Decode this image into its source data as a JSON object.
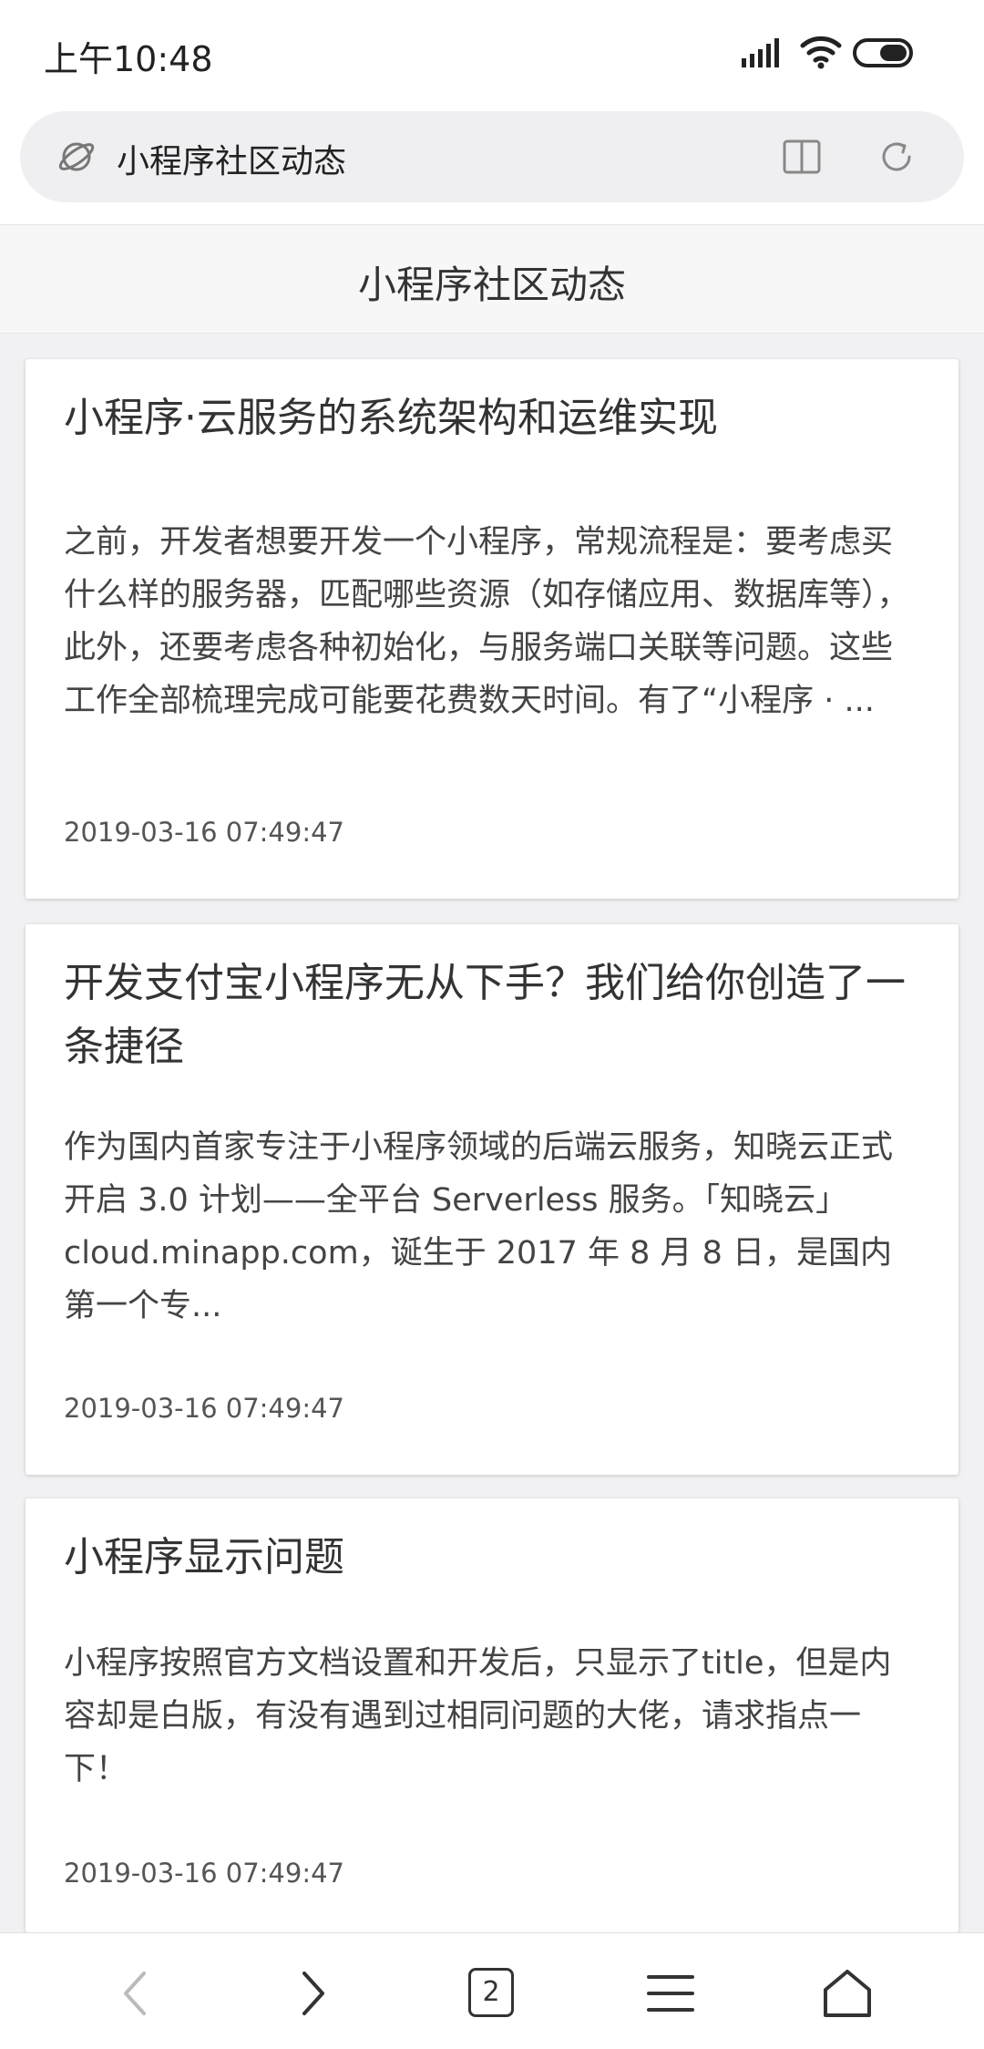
{
  "status_bar": {
    "time": "上午10:48"
  },
  "browser": {
    "address": "小程序社区动态",
    "tab_count": "2"
  },
  "page": {
    "title": "小程序社区动态"
  },
  "posts": [
    {
      "title": "小程序·云服务的系统架构和运维实现",
      "summary": "之前，开发者想要开发一个小程序，常规流程是：要考虑买什么样的服务器，匹配哪些资源（如存储应用、数据库等），此外，还要考虑各种初始化，与服务端口关联等问题。这些工作全部梳理完成可能要花费数天时间。有了“小程序 · ...",
      "date": "2019-03-16 07:49:47"
    },
    {
      "title": "开发支付宝小程序无从下手？我们给你创造了一条捷径",
      "summary": "作为国内首家专注于小程序领域的后端云服务，知晓云正式开启 3.0 计划——全平台 Serverless 服务。「知晓云」cloud.minapp.com，诞生于 2017 年 8 月 8 日，是国内第一个专...",
      "date": "2019-03-16 07:49:47"
    },
    {
      "title": "小程序显示问题",
      "summary": "小程序按照官方文档设置和开发后，只显示了title，但是内容却是白版，有没有遇到过相同问题的大佬，请求指点一下！",
      "date": "2019-03-16 07:49:47"
    }
  ],
  "icons": {
    "signal": "signal-icon",
    "wifi": "wifi-icon",
    "battery": "battery-icon",
    "planet": "planet-icon",
    "reader": "reader-mode-icon",
    "refresh": "refresh-icon",
    "back": "back-arrow-icon",
    "forward": "forward-arrow-icon",
    "menu": "menu-icon",
    "home": "home-icon"
  }
}
